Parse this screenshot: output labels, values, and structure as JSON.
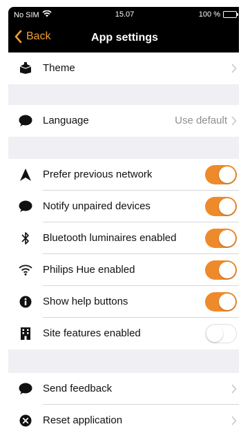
{
  "colors": {
    "accent": "#ee8a2a",
    "background": "#efeff4",
    "nav_background": "#000000",
    "back_text": "#f0a030"
  },
  "status_bar": {
    "carrier": "No SIM",
    "time": "15.07",
    "battery": "100 %"
  },
  "nav": {
    "back_label": "Back",
    "title": "App settings"
  },
  "sections": {
    "theme": {
      "icon": "paint-bucket-icon",
      "label": "Theme"
    },
    "language": {
      "icon": "speech-bubble-icon",
      "label": "Language",
      "value": "Use default"
    },
    "toggles": [
      {
        "icon": "navigation-arrow-icon",
        "label": "Prefer previous network",
        "on": true
      },
      {
        "icon": "speech-bubble-icon",
        "label": "Notify unpaired devices",
        "on": true
      },
      {
        "icon": "bluetooth-icon",
        "label": "Bluetooth luminaires enabled",
        "on": true
      },
      {
        "icon": "wifi-icon",
        "label": "Philips Hue enabled",
        "on": true
      },
      {
        "icon": "info-icon",
        "label": "Show help buttons",
        "on": true
      },
      {
        "icon": "building-icon",
        "label": "Site features enabled",
        "on": false
      }
    ],
    "feedback": {
      "icon": "speech-bubble-icon",
      "label": "Send feedback"
    },
    "reset": {
      "icon": "close-circle-icon",
      "label": "Reset application"
    }
  }
}
